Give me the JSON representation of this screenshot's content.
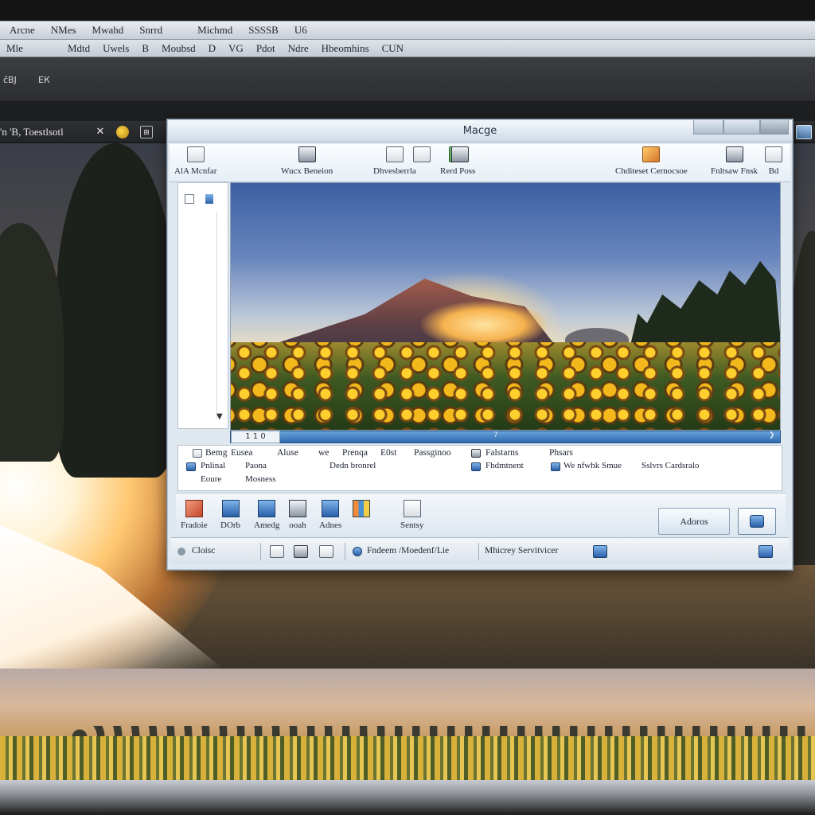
{
  "host": {
    "menu": [
      "Arcne",
      "NMes",
      "Mwahd",
      "Snrrd",
      "Michmd",
      "SSSSB",
      "U6"
    ],
    "toolbar": [
      "Mle",
      "Mdtd",
      "Uwels",
      "B",
      "Moubsd",
      "D",
      "VG",
      "Pdot",
      "Ndre",
      "Hbeomhins",
      "CUN"
    ],
    "status": {
      "left": "ĉBJ",
      "right": "ЕК"
    },
    "tab_title": "'n 'B, Toestlsotl",
    "tab_icons": [
      "close-x-icon",
      "settings-dot-icon",
      "box-icon",
      "box-icon-2"
    ]
  },
  "window": {
    "title": "Macge",
    "ribbon": [
      {
        "label": "AlA Mcnfar",
        "icon": "doc"
      },
      {
        "label": "Wucx Beneion",
        "icon": "dark"
      },
      {
        "label": "Dhvesberrla",
        "icon": "doc"
      },
      {
        "label": "Rerd Poss",
        "icon": "green"
      },
      {
        "label": "",
        "icon": "doc"
      },
      {
        "label": "",
        "icon": "dark"
      },
      {
        "label": "Chditeset Cernocsoe",
        "icon": "orange"
      },
      {
        "label": "Fnltsaw Fnsk",
        "icon": "dark"
      },
      {
        "label": "Bd",
        "icon": "doc"
      }
    ],
    "photo_page": "1 1 0",
    "photo_scroll_mid": "7",
    "props": {
      "headers": [
        "Bemg",
        "Eusea",
        "Aluse",
        "we",
        "Prenqa",
        "E0st",
        "Passginoo",
        "Falstarns",
        "Phsars"
      ],
      "row1": [
        "Pnlinal",
        "Paona",
        "Dedn bronrel",
        "Fhdmtnent",
        "We nfwhk Smue",
        "Sslvrs Cardsralo"
      ],
      "row2": [
        "Eoure",
        "Mosness"
      ]
    },
    "actions": [
      "Fradoie",
      "DOrb",
      "Amedg",
      "ooah",
      "Adnes",
      "",
      "Sentsy"
    ],
    "primary_button": "Adoros",
    "status": [
      "Cloisc",
      "Fndeem /Moedenf/Lie",
      "Mhicrey Servitvicer"
    ]
  },
  "colors": {
    "accent": "#2e6aad",
    "title_bg": "#dbe6f1",
    "field_yellow": "#ffcf2e",
    "sky_blue": "#3b5fa2"
  }
}
